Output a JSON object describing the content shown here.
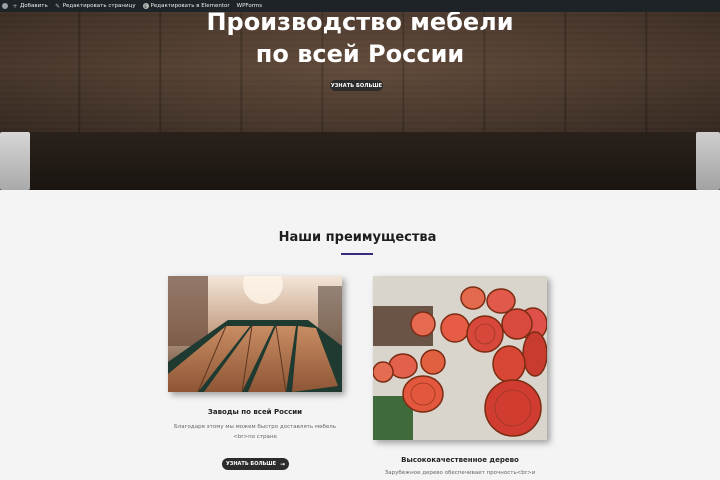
{
  "admin_bar": {
    "items": [
      {
        "icon": "plus-icon",
        "label": "Добавить"
      },
      {
        "icon": "pencil-icon",
        "label": "Редактировать страницу"
      },
      {
        "icon": "elementor-icon",
        "label": "Редактировать в Elementor"
      },
      {
        "icon": "",
        "label": "WPForms"
      }
    ]
  },
  "hero": {
    "title_line1": "Производство мебели",
    "title_line2": "по всей России",
    "button_label": "УЗНАТЬ БОЛЬШЕ"
  },
  "advantages": {
    "title": "Наши преимущества",
    "accent_color": "#3b2a7a",
    "cards": [
      {
        "image_name": "factory-wood-boards-image",
        "title": "Заводы по всей России",
        "text_line1": "Благодаря этому мы можем быстро доставлять мебель",
        "text_line2": "<br>по стране",
        "button_label": "УЗНАТЬ БОЛЬШЕ"
      },
      {
        "image_name": "red-logs-image",
        "title": "Высококачественное дерево",
        "text_line1": "Зарубежное дерево обеспечивает прочность<br>и"
      }
    ]
  }
}
